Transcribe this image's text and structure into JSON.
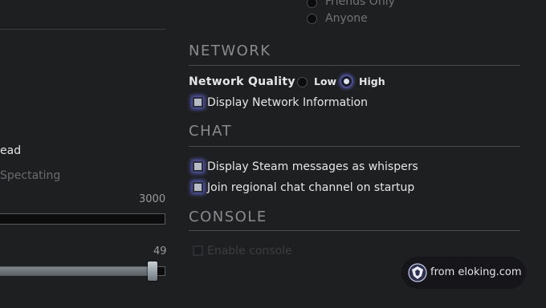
{
  "privacy_options": [
    {
      "label": "Friends Only",
      "selected": false
    },
    {
      "label": "Anyone",
      "selected": false
    }
  ],
  "left_column": {
    "dead_label": "ead",
    "spectating_label": "Spectating",
    "slider1_value": "3000",
    "slider2_value": "49"
  },
  "network": {
    "header": "NETWORK",
    "quality_label": "Network Quality",
    "quality_options": [
      {
        "label": "Low",
        "selected": false
      },
      {
        "label": "High",
        "selected": true
      }
    ],
    "display_info_label": "Display Network Information"
  },
  "chat": {
    "header": "CHAT",
    "steam_whispers_label": "Display Steam messages as whispers",
    "regional_channel_label": "Join regional chat channel on startup"
  },
  "console": {
    "header": "CONSOLE",
    "enable_label": "Enable console"
  },
  "watermark": {
    "text": "from eloking.com",
    "logo_icon": "eloking-logo-icon"
  },
  "colors": {
    "background": "#1e1f21",
    "accent_glow": "#5e62c6",
    "text": "#e6e6e6",
    "header_text": "#8a8b8e"
  }
}
